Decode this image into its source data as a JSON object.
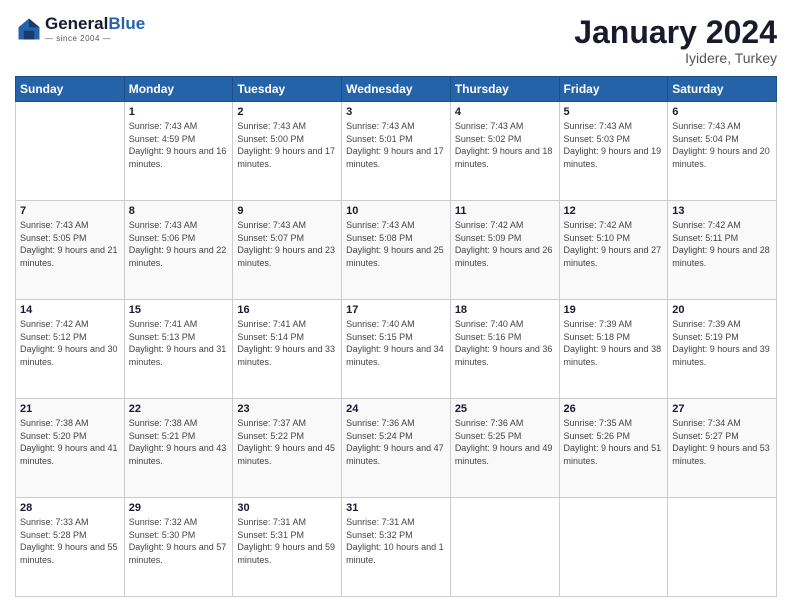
{
  "header": {
    "logo_line1": "General",
    "logo_line2": "Blue",
    "month_title": "January 2024",
    "location": "Iyidere, Turkey"
  },
  "weekdays": [
    "Sunday",
    "Monday",
    "Tuesday",
    "Wednesday",
    "Thursday",
    "Friday",
    "Saturday"
  ],
  "weeks": [
    [
      {
        "day": "",
        "sunrise": "",
        "sunset": "",
        "daylight": ""
      },
      {
        "day": "1",
        "sunrise": "Sunrise: 7:43 AM",
        "sunset": "Sunset: 4:59 PM",
        "daylight": "Daylight: 9 hours and 16 minutes."
      },
      {
        "day": "2",
        "sunrise": "Sunrise: 7:43 AM",
        "sunset": "Sunset: 5:00 PM",
        "daylight": "Daylight: 9 hours and 17 minutes."
      },
      {
        "day": "3",
        "sunrise": "Sunrise: 7:43 AM",
        "sunset": "Sunset: 5:01 PM",
        "daylight": "Daylight: 9 hours and 17 minutes."
      },
      {
        "day": "4",
        "sunrise": "Sunrise: 7:43 AM",
        "sunset": "Sunset: 5:02 PM",
        "daylight": "Daylight: 9 hours and 18 minutes."
      },
      {
        "day": "5",
        "sunrise": "Sunrise: 7:43 AM",
        "sunset": "Sunset: 5:03 PM",
        "daylight": "Daylight: 9 hours and 19 minutes."
      },
      {
        "day": "6",
        "sunrise": "Sunrise: 7:43 AM",
        "sunset": "Sunset: 5:04 PM",
        "daylight": "Daylight: 9 hours and 20 minutes."
      }
    ],
    [
      {
        "day": "7",
        "sunrise": "Sunrise: 7:43 AM",
        "sunset": "Sunset: 5:05 PM",
        "daylight": "Daylight: 9 hours and 21 minutes."
      },
      {
        "day": "8",
        "sunrise": "Sunrise: 7:43 AM",
        "sunset": "Sunset: 5:06 PM",
        "daylight": "Daylight: 9 hours and 22 minutes."
      },
      {
        "day": "9",
        "sunrise": "Sunrise: 7:43 AM",
        "sunset": "Sunset: 5:07 PM",
        "daylight": "Daylight: 9 hours and 23 minutes."
      },
      {
        "day": "10",
        "sunrise": "Sunrise: 7:43 AM",
        "sunset": "Sunset: 5:08 PM",
        "daylight": "Daylight: 9 hours and 25 minutes."
      },
      {
        "day": "11",
        "sunrise": "Sunrise: 7:42 AM",
        "sunset": "Sunset: 5:09 PM",
        "daylight": "Daylight: 9 hours and 26 minutes."
      },
      {
        "day": "12",
        "sunrise": "Sunrise: 7:42 AM",
        "sunset": "Sunset: 5:10 PM",
        "daylight": "Daylight: 9 hours and 27 minutes."
      },
      {
        "day": "13",
        "sunrise": "Sunrise: 7:42 AM",
        "sunset": "Sunset: 5:11 PM",
        "daylight": "Daylight: 9 hours and 28 minutes."
      }
    ],
    [
      {
        "day": "14",
        "sunrise": "Sunrise: 7:42 AM",
        "sunset": "Sunset: 5:12 PM",
        "daylight": "Daylight: 9 hours and 30 minutes."
      },
      {
        "day": "15",
        "sunrise": "Sunrise: 7:41 AM",
        "sunset": "Sunset: 5:13 PM",
        "daylight": "Daylight: 9 hours and 31 minutes."
      },
      {
        "day": "16",
        "sunrise": "Sunrise: 7:41 AM",
        "sunset": "Sunset: 5:14 PM",
        "daylight": "Daylight: 9 hours and 33 minutes."
      },
      {
        "day": "17",
        "sunrise": "Sunrise: 7:40 AM",
        "sunset": "Sunset: 5:15 PM",
        "daylight": "Daylight: 9 hours and 34 minutes."
      },
      {
        "day": "18",
        "sunrise": "Sunrise: 7:40 AM",
        "sunset": "Sunset: 5:16 PM",
        "daylight": "Daylight: 9 hours and 36 minutes."
      },
      {
        "day": "19",
        "sunrise": "Sunrise: 7:39 AM",
        "sunset": "Sunset: 5:18 PM",
        "daylight": "Daylight: 9 hours and 38 minutes."
      },
      {
        "day": "20",
        "sunrise": "Sunrise: 7:39 AM",
        "sunset": "Sunset: 5:19 PM",
        "daylight": "Daylight: 9 hours and 39 minutes."
      }
    ],
    [
      {
        "day": "21",
        "sunrise": "Sunrise: 7:38 AM",
        "sunset": "Sunset: 5:20 PM",
        "daylight": "Daylight: 9 hours and 41 minutes."
      },
      {
        "day": "22",
        "sunrise": "Sunrise: 7:38 AM",
        "sunset": "Sunset: 5:21 PM",
        "daylight": "Daylight: 9 hours and 43 minutes."
      },
      {
        "day": "23",
        "sunrise": "Sunrise: 7:37 AM",
        "sunset": "Sunset: 5:22 PM",
        "daylight": "Daylight: 9 hours and 45 minutes."
      },
      {
        "day": "24",
        "sunrise": "Sunrise: 7:36 AM",
        "sunset": "Sunset: 5:24 PM",
        "daylight": "Daylight: 9 hours and 47 minutes."
      },
      {
        "day": "25",
        "sunrise": "Sunrise: 7:36 AM",
        "sunset": "Sunset: 5:25 PM",
        "daylight": "Daylight: 9 hours and 49 minutes."
      },
      {
        "day": "26",
        "sunrise": "Sunrise: 7:35 AM",
        "sunset": "Sunset: 5:26 PM",
        "daylight": "Daylight: 9 hours and 51 minutes."
      },
      {
        "day": "27",
        "sunrise": "Sunrise: 7:34 AM",
        "sunset": "Sunset: 5:27 PM",
        "daylight": "Daylight: 9 hours and 53 minutes."
      }
    ],
    [
      {
        "day": "28",
        "sunrise": "Sunrise: 7:33 AM",
        "sunset": "Sunset: 5:28 PM",
        "daylight": "Daylight: 9 hours and 55 minutes."
      },
      {
        "day": "29",
        "sunrise": "Sunrise: 7:32 AM",
        "sunset": "Sunset: 5:30 PM",
        "daylight": "Daylight: 9 hours and 57 minutes."
      },
      {
        "day": "30",
        "sunrise": "Sunrise: 7:31 AM",
        "sunset": "Sunset: 5:31 PM",
        "daylight": "Daylight: 9 hours and 59 minutes."
      },
      {
        "day": "31",
        "sunrise": "Sunrise: 7:31 AM",
        "sunset": "Sunset: 5:32 PM",
        "daylight": "Daylight: 10 hours and 1 minute."
      },
      {
        "day": "",
        "sunrise": "",
        "sunset": "",
        "daylight": ""
      },
      {
        "day": "",
        "sunrise": "",
        "sunset": "",
        "daylight": ""
      },
      {
        "day": "",
        "sunrise": "",
        "sunset": "",
        "daylight": ""
      }
    ]
  ]
}
